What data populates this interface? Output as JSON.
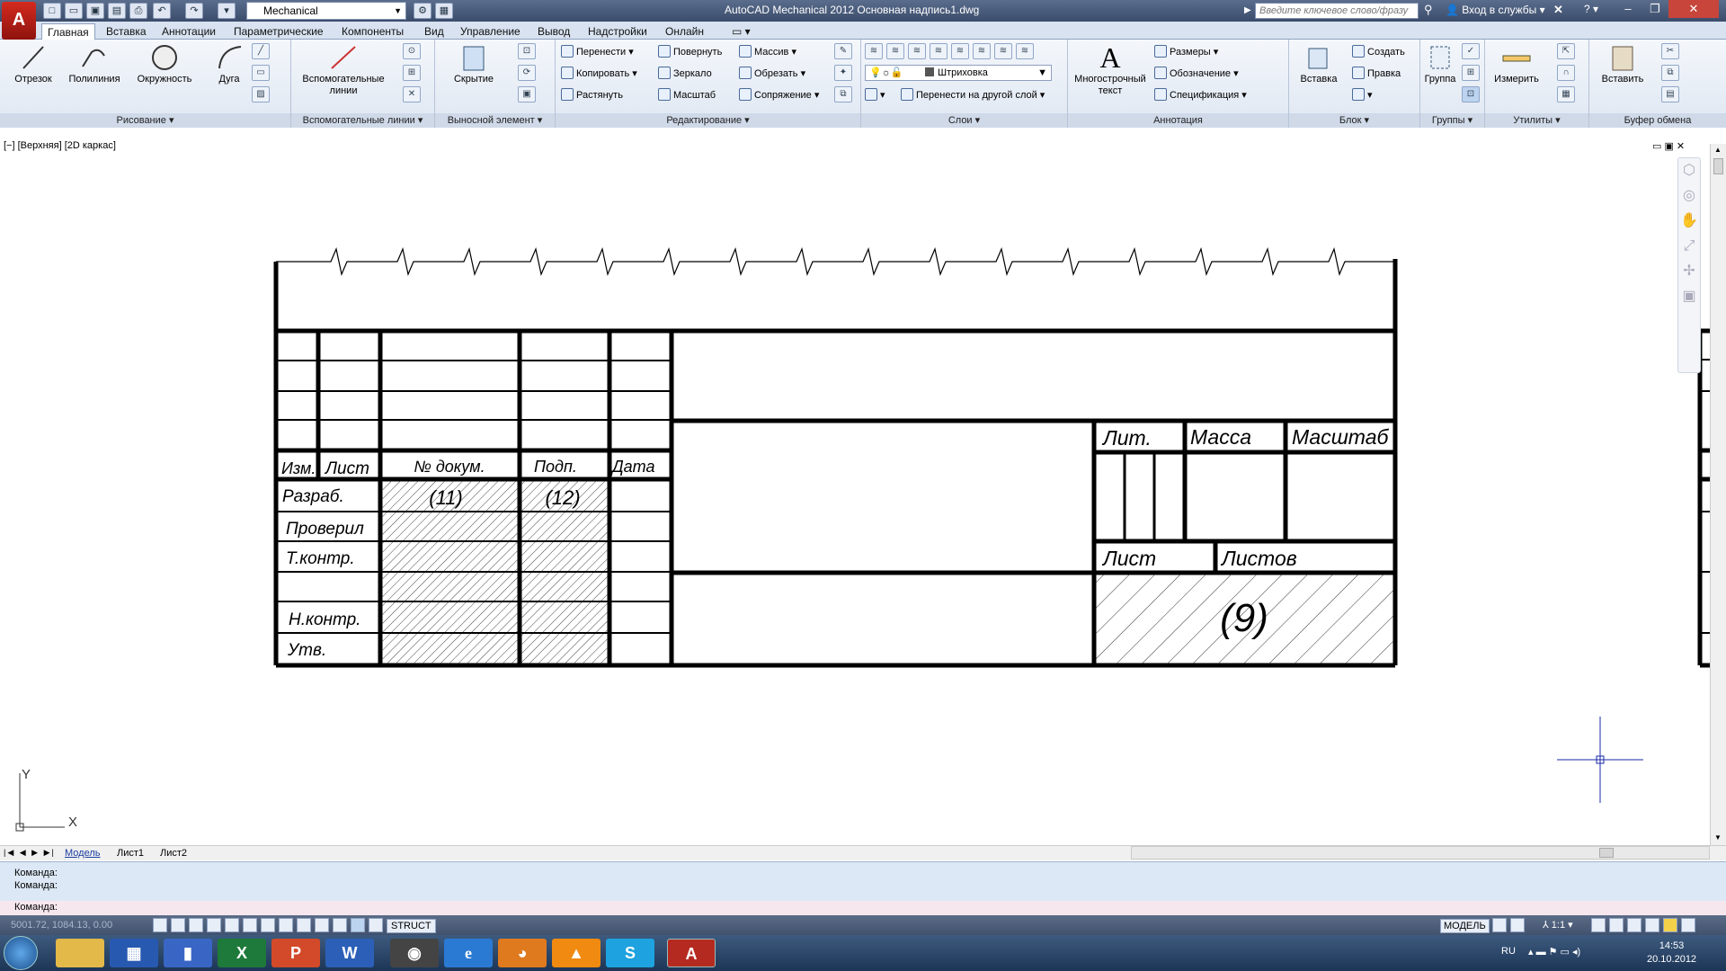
{
  "app": {
    "title": "AutoCAD Mechanical 2012    Основная надпись1.dwg",
    "workspace": "Mechanical",
    "search_placeholder": "Введите ключевое слово/фразу",
    "signin": "Вход в службы",
    "logo": "A"
  },
  "tabs": [
    "Главная",
    "Вставка",
    "Аннотации",
    "Параметрические",
    "Компоненты",
    "Вид",
    "Управление",
    "Вывод",
    "Надстройки",
    "Онлайн"
  ],
  "ribbon": {
    "draw": {
      "title": "Рисование",
      "buttons": [
        "Отрезок",
        "Полилиния",
        "Окружность",
        "Дуга"
      ]
    },
    "construction": {
      "title": "Вспомогательные линии",
      "button": "Вспомогательные линии"
    },
    "detail": {
      "title": "Выносной элемент",
      "button": "Скрытие"
    },
    "modify": {
      "title": "Редактирование",
      "items": [
        "Перенести",
        "Повернуть",
        "Массив",
        "Копировать",
        "Зеркало",
        "Обрезать",
        "Растянуть",
        "Масштаб",
        "Сопряжение"
      ]
    },
    "layers": {
      "title": "Слои",
      "hatch": "Штриховка",
      "move_layer": "Перенести на другой слой"
    },
    "annotation": {
      "title": "Аннотация",
      "mtext": "Многострочный текст",
      "items": [
        "Размеры",
        "Обозначение",
        "Спецификация"
      ]
    },
    "block": {
      "title": "Блок",
      "insert": "Вставка",
      "items": [
        "Создать",
        "Правка"
      ]
    },
    "groups": {
      "title": "Группы",
      "button": "Группа"
    },
    "utilities": {
      "title": "Утилиты",
      "button": "Измерить"
    },
    "clipboard": {
      "title": "Буфер обмена",
      "button": "Вставить"
    }
  },
  "viewport": {
    "label": "[−] [Верхняя] [2D каркас]"
  },
  "stamp": {
    "header": [
      "Изм.",
      "Лист",
      "№ докум.",
      "Подп.",
      "Дата"
    ],
    "rows": [
      "Разраб.",
      "Проверил",
      "Т.контр.",
      "",
      "Н.контр.",
      "Утв."
    ],
    "f11": "(11)",
    "f12": "(12)",
    "lit": "Лит.",
    "mass": "Масса",
    "scale": "Масштаб",
    "sheet": "Лист",
    "sheets": "Листов",
    "f9": "(9)"
  },
  "ucs": {
    "x": "X",
    "y": "Y"
  },
  "layout_tabs": [
    "Модель",
    "Лист1",
    "Лист2"
  ],
  "command": {
    "lines": [
      "Команда:",
      "Команда:"
    ],
    "prompt": "Команда:"
  },
  "status": {
    "coords": "5001.72, 1084.13, 0.00",
    "struct": "STRUCT",
    "model": "МОДЕЛЬ",
    "scale": "1:1"
  },
  "tray": {
    "lang": "RU",
    "time": "14:53",
    "date": "20.10.2012"
  }
}
